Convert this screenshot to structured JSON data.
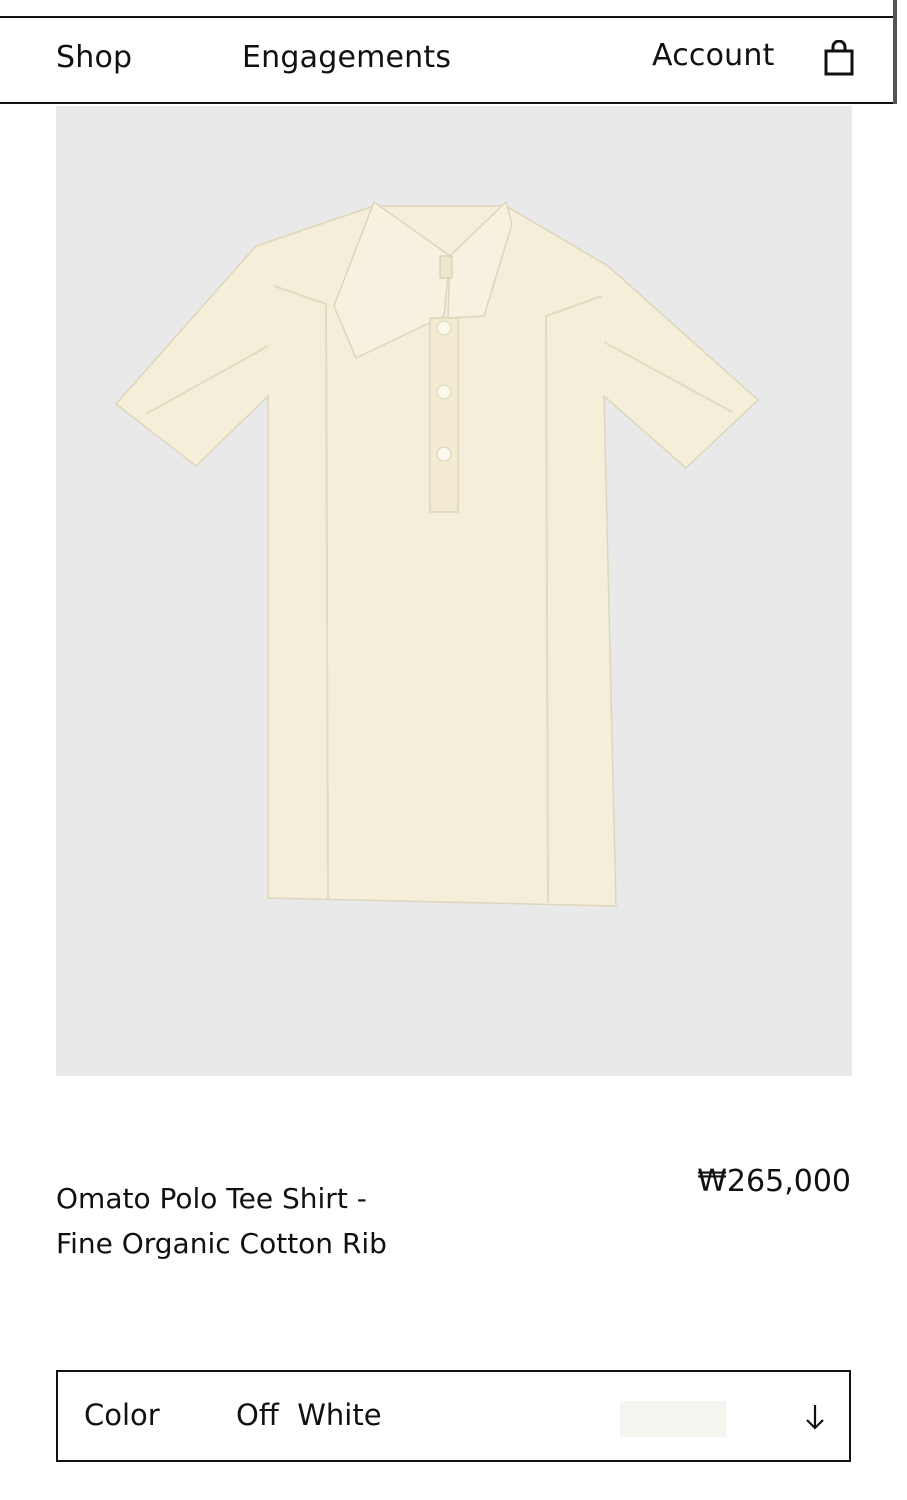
{
  "nav": {
    "shop_label": "Shop",
    "engagements_label": "Engagements",
    "account_label": "Account",
    "bag_icon": "shopping-bag-icon"
  },
  "product": {
    "image_icon": "polo-tee-shirt-image",
    "title_line1": "Omato Polo Tee Shirt -",
    "title_line2": "Fine Organic Cotton Rib",
    "price": "₩265,000"
  },
  "color_select": {
    "label": "Color",
    "value": "Off  White",
    "swatch_color": "#f6f4ef",
    "arrow_icon": "arrow-down-icon"
  },
  "colors": {
    "garment": "#f5efd9",
    "image_background": "#e9e9e9"
  }
}
